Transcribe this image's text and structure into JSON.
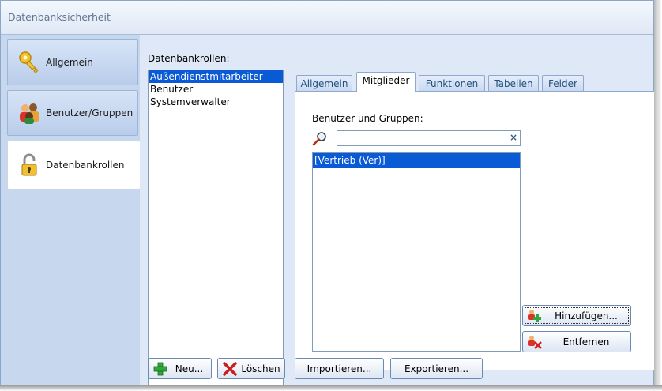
{
  "window": {
    "title": "Datenbanksicherheit"
  },
  "nav": {
    "items": [
      {
        "label": "Allgemein",
        "icon": "key-icon"
      },
      {
        "label": "Benutzer/Gruppen",
        "icon": "users-icon"
      },
      {
        "label": "Datenbankrollen",
        "icon": "padlock-icon",
        "active": true
      }
    ]
  },
  "roles": {
    "label": "Datenbankrollen:",
    "items": [
      "Außendienstmitarbeiter",
      "Benutzer",
      "Systemverwalter"
    ],
    "selected": 0
  },
  "tabs": [
    "Allgemein",
    "Mitglieder",
    "Funktionen",
    "Tabellen",
    "Felder"
  ],
  "active_tab": 1,
  "members": {
    "label": "Benutzer und Gruppen:",
    "search_value": "",
    "clear_symbol": "×",
    "items": [
      "[Vertrieb (Ver)]"
    ],
    "selected": 0,
    "add_label": "Hinzufügen...",
    "remove_label": "Entfernen"
  },
  "bottom_buttons": {
    "new_label": "Neu...",
    "delete_label": "Löschen",
    "import_label": "Importieren...",
    "export_label": "Exportieren..."
  },
  "colors": {
    "selection": "#0a5ad6",
    "panel": "#dfe8f6",
    "nav": "#c7d7ee"
  }
}
